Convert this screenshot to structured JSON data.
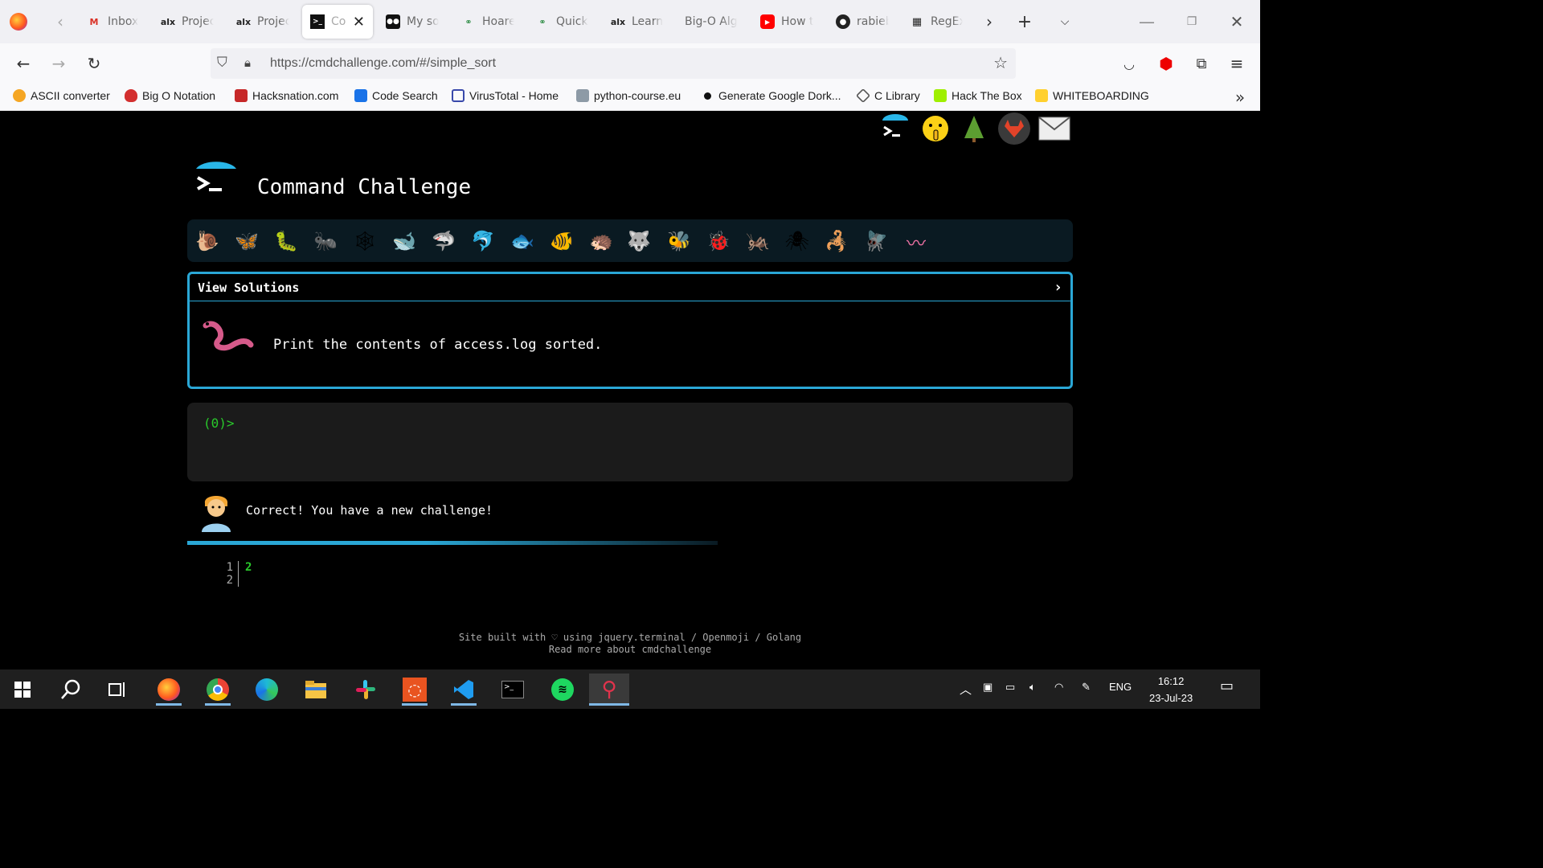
{
  "browser": {
    "tabs": [
      {
        "label": "Inbox",
        "icon": "gmail-icon"
      },
      {
        "label": "Projec",
        "icon": "alx-icon"
      },
      {
        "label": "Projec",
        "icon": "alx-icon"
      },
      {
        "label": "Cor",
        "icon": "terminal-icon",
        "active": true
      },
      {
        "label": "My so",
        "icon": "medium-icon"
      },
      {
        "label": "Hoare",
        "icon": "geeksforgeeks-icon"
      },
      {
        "label": "Quick",
        "icon": "geeksforgeeks-icon"
      },
      {
        "label": "Learn",
        "icon": "alx-icon"
      },
      {
        "label": "Big-O Alg",
        "icon": "none"
      },
      {
        "label": "How t",
        "icon": "youtube-icon"
      },
      {
        "label": "rabieb",
        "icon": "github-icon"
      },
      {
        "label": "RegEx",
        "icon": "regex-icon"
      }
    ],
    "url": "https://cmdchallenge.com/#/simple_sort",
    "bookmarks": [
      {
        "label": "ASCII converter"
      },
      {
        "label": "Big O Notation"
      },
      {
        "label": "Hacksnation.com"
      },
      {
        "label": "Code Search"
      },
      {
        "label": "VirusTotal - Home"
      },
      {
        "label": "python-course.eu"
      },
      {
        "label": "Generate Google Dork..."
      },
      {
        "label": "C Library"
      },
      {
        "label": "Hack The Box"
      },
      {
        "label": "WHITEBOARDING"
      }
    ]
  },
  "site": {
    "title": "Command Challenge",
    "top_icons": [
      "terminal-logo-icon",
      "shush-face-icon",
      "tree-icon",
      "gitlab-icon",
      "mail-icon"
    ],
    "challenge_icons": [
      "snail",
      "butterfly",
      "caterpillar",
      "ant",
      "spiderweb",
      "whale",
      "shark",
      "dolphin",
      "fish",
      "tropical-fish",
      "hedgehog",
      "wolf",
      "bee",
      "ladybug",
      "cricket",
      "spider",
      "scorpion",
      "fly",
      "worm"
    ],
    "view_solutions": "View Solutions",
    "task": "Print the contents of access.log sorted.",
    "prompt": "(0)>",
    "feedback": "Correct! You have a new challenge!",
    "code_lines": [
      {
        "num": "1",
        "text": "2"
      },
      {
        "num": "2",
        "text": ""
      }
    ],
    "footer_line1": "Site built with ♡ using jquery.terminal / Openmoji / Golang",
    "footer_line2": "Read more about cmdchallenge"
  },
  "taskbar": {
    "apps": [
      "windows-start-icon",
      "search-icon",
      "task-view-icon",
      "firefox-icon",
      "chrome-icon",
      "edge-icon",
      "file-explorer-icon",
      "slack-icon",
      "ubuntu-icon",
      "vscode-icon",
      "terminal-icon",
      "spotify-icon",
      "cmdchallenge-icon"
    ],
    "language": "ENG",
    "time": "16:12",
    "date": "23-Jul-23"
  },
  "colors": {
    "accent": "#2aa7d6",
    "terminal_green": "#29c92b",
    "background": "#000000"
  }
}
